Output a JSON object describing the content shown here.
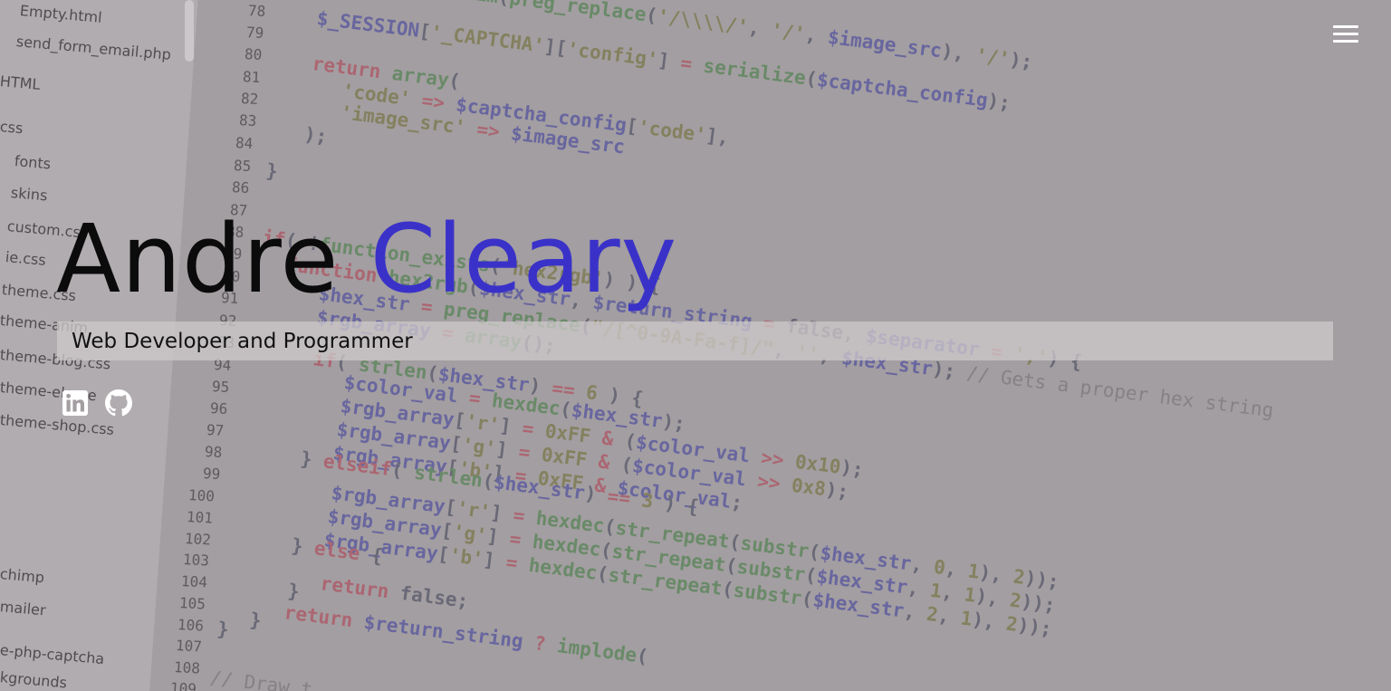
{
  "hero": {
    "first_name": "Andre",
    "last_name": "Cleary",
    "subtitle": "Web Developer and Programmer"
  },
  "social": [
    {
      "name": "LinkedIn",
      "icon": "linkedin-icon"
    },
    {
      "name": "GitHub",
      "icon": "github-icon"
    }
  ],
  "nav": {
    "menu_icon": "hamburger-menu-icon"
  },
  "background": {
    "sidebar_files": [
      "Empty.html",
      "send_form_email.php",
      "HTML",
      "css",
      "fonts",
      "skins",
      "custom.css",
      "ie.css",
      "theme.css",
      "theme-anim",
      "theme-blog.css",
      "theme-eleme",
      "theme-shop.css",
      "chimp",
      "mailer",
      "e-php-captcha",
      "kgrounds"
    ],
    "line_numbers": [
      "78",
      "79",
      "80",
      "81",
      "82",
      "83",
      "84",
      "85",
      "86",
      "87",
      "88",
      "89",
      "90",
      "91",
      "92",
      "93",
      "94",
      "95",
      "96",
      "97",
      "98",
      "99",
      "100",
      "101",
      "102",
      "103",
      "104",
      "105",
      "106",
      "107",
      "108",
      "109"
    ]
  },
  "colors": {
    "background": "#a39ea1",
    "first_name": "#0b0b0b",
    "last_name": "#3a32c8",
    "subtitle_bar": "#cdc9cb",
    "icons": "#ffffff"
  }
}
